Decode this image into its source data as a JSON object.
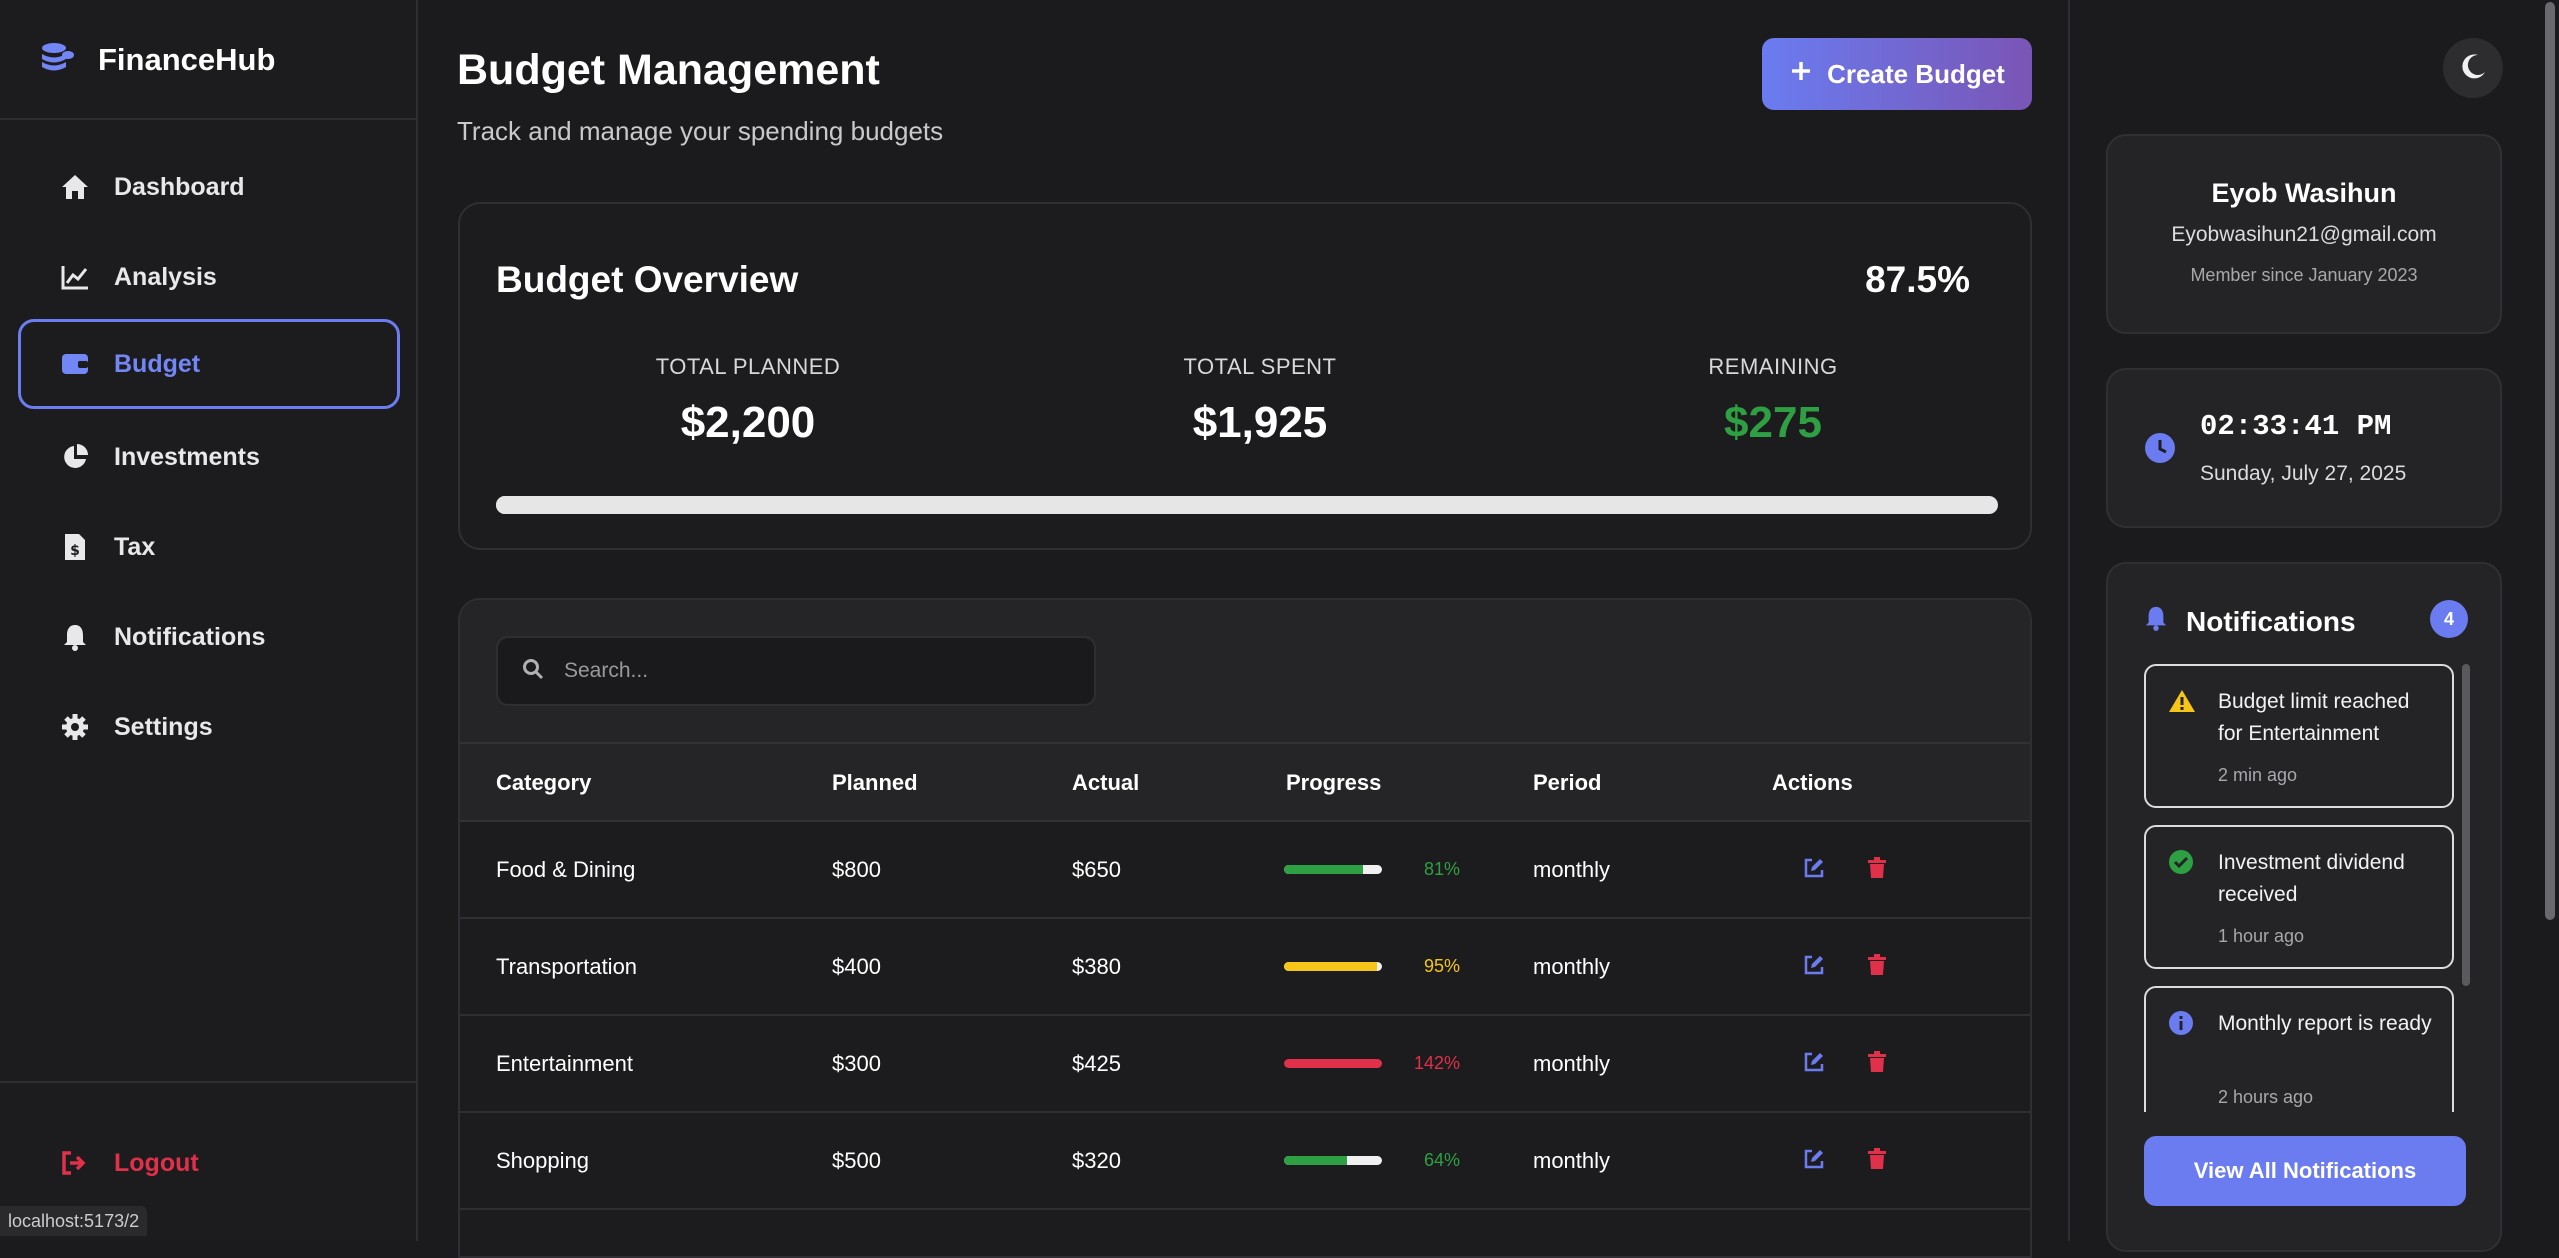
{
  "app": {
    "brand": "FinanceHub",
    "status_url": "localhost:5173/2"
  },
  "sidebar": {
    "items": [
      {
        "label": "Dashboard",
        "icon": "home-icon",
        "active": false
      },
      {
        "label": "Analysis",
        "icon": "chart-line-icon",
        "active": false
      },
      {
        "label": "Budget",
        "icon": "wallet-icon",
        "active": true
      },
      {
        "label": "Investments",
        "icon": "pie-chart-icon",
        "active": false
      },
      {
        "label": "Tax",
        "icon": "tax-document-icon",
        "active": false
      },
      {
        "label": "Notifications",
        "icon": "bell-icon",
        "active": false
      },
      {
        "label": "Settings",
        "icon": "gear-icon",
        "active": false
      }
    ],
    "logout_label": "Logout"
  },
  "header": {
    "title": "Budget Management",
    "subtitle": "Track and manage your spending budgets",
    "create_label": "Create Budget"
  },
  "overview": {
    "title": "Budget Overview",
    "percent": "87.5%",
    "progress_fraction": 0.875,
    "planned_label": "TOTAL PLANNED",
    "planned_value": "$2,200",
    "spent_label": "TOTAL SPENT",
    "spent_value": "$1,925",
    "remaining_label": "REMAINING",
    "remaining_value": "$275"
  },
  "search": {
    "placeholder": "Search..."
  },
  "table": {
    "headers": {
      "category": "Category",
      "planned": "Planned",
      "actual": "Actual",
      "progress": "Progress",
      "period": "Period",
      "actions": "Actions"
    },
    "rows": [
      {
        "category": "Food & Dining",
        "planned": "$800",
        "actual": "$650",
        "percent": "81%",
        "fraction": 0.81,
        "color": "#2ea043",
        "period": "monthly"
      },
      {
        "category": "Transportation",
        "planned": "$400",
        "actual": "$380",
        "percent": "95%",
        "fraction": 0.95,
        "color": "#f5c518",
        "period": "monthly"
      },
      {
        "category": "Entertainment",
        "planned": "$300",
        "actual": "$425",
        "percent": "142%",
        "fraction": 1.0,
        "color": "#e0304a",
        "period": "monthly"
      },
      {
        "category": "Shopping",
        "planned": "$500",
        "actual": "$320",
        "percent": "64%",
        "fraction": 0.64,
        "color": "#2ea043",
        "period": "monthly"
      }
    ]
  },
  "user": {
    "name": "Eyob Wasihun",
    "email": "Eyobwasihun21@gmail.com",
    "member_since": "Member since January 2023"
  },
  "clock": {
    "time": "02:33:41 PM",
    "date": "Sunday, July 27, 2025"
  },
  "notifications": {
    "title": "Notifications",
    "count": "4",
    "items": [
      {
        "text": "Budget limit reached for Entertainment",
        "time": "2 min ago",
        "icon": "warning-icon"
      },
      {
        "text": "Investment dividend received",
        "time": "1 hour ago",
        "icon": "check-circle-icon"
      },
      {
        "text": "Monthly report is ready",
        "time": "2 hours ago",
        "icon": "info-icon"
      }
    ],
    "view_all_label": "View All Notifications"
  },
  "colors": {
    "accent": "#6a7cf0",
    "success": "#2ea043",
    "warning": "#f5c518",
    "danger": "#e0304a"
  }
}
